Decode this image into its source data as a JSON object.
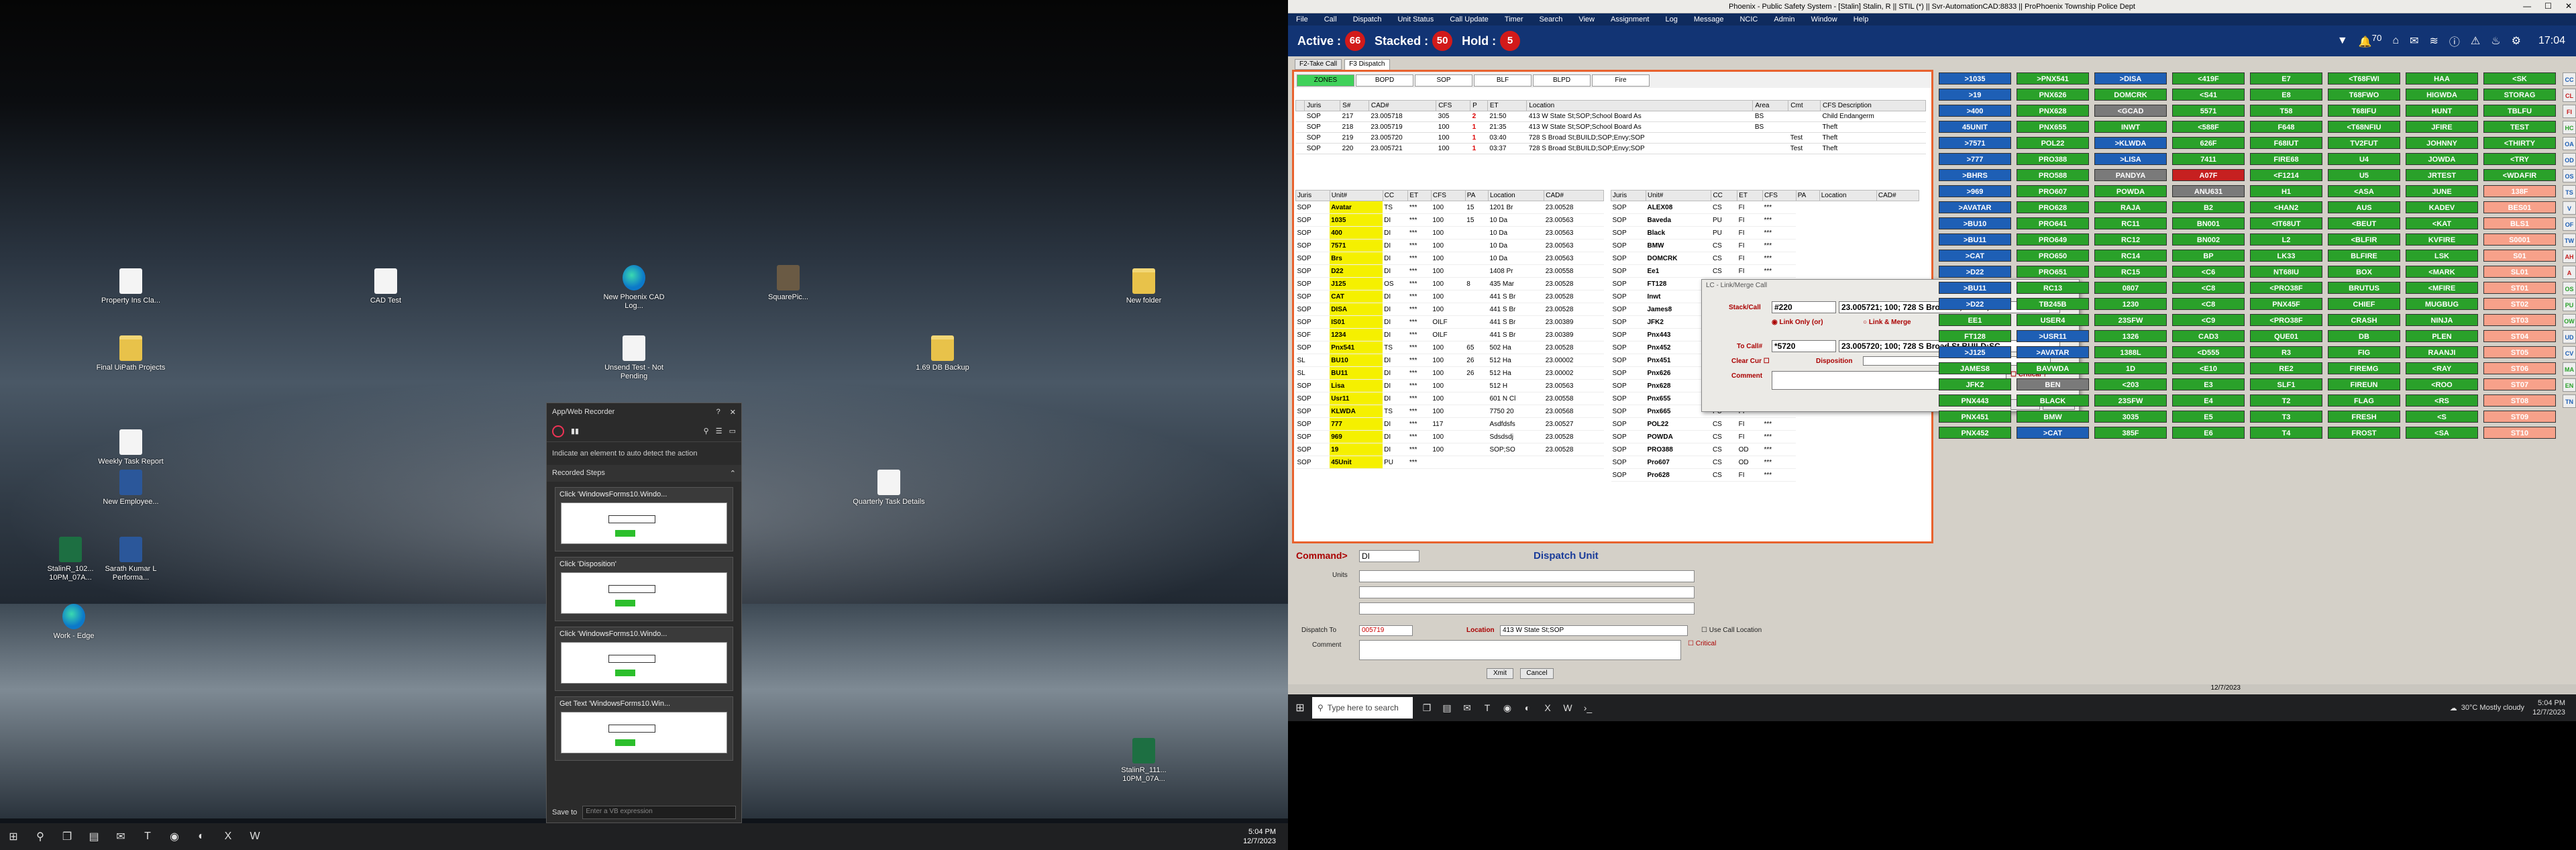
{
  "left_desktop": {
    "icons": [
      {
        "label": "Property Ins Cla...",
        "type": "doc"
      },
      {
        "label": "CAD Test",
        "type": "doc"
      },
      {
        "label": "New Phoenix CAD Log...",
        "type": "edge"
      },
      {
        "label": "SquarePic...",
        "type": "photo"
      },
      {
        "label": "New folder",
        "type": "folder"
      },
      {
        "label": "Final UiPath Projects",
        "type": "folder"
      },
      {
        "label": "Unsend Test - Not Pending",
        "type": "doc"
      },
      {
        "label": "1.69 DB Backup",
        "type": "folder"
      },
      {
        "label": "Weekly Task Report",
        "type": "doc"
      },
      {
        "label": "New Employee...",
        "type": "word"
      },
      {
        "label": "Quarterly Task Details",
        "type": "doc"
      },
      {
        "label": "StalinR_102... 10PM_07A...",
        "type": "excel"
      },
      {
        "label": "Sarath Kumar L Performa...",
        "type": "word"
      },
      {
        "label": "Work - Edge",
        "type": "edge"
      },
      {
        "label": "StalinR_111... 10PM_07A...",
        "type": "excel"
      }
    ],
    "recorder": {
      "title": "App/Web Recorder",
      "hint": "Indicate an element to auto detect the action",
      "recorded_steps": "Recorded Steps",
      "steps": [
        "Click 'WindowsForms10.Windo...",
        "Click 'Disposition'",
        "Click 'WindowsForms10.Windo...",
        "Get Text 'WindowsForms10.Win..."
      ],
      "save_to": "Save to",
      "save_placeholder": "Enter a VB expression"
    },
    "taskbar": {
      "time": "5:04 PM",
      "date": "12/7/2023"
    }
  },
  "app": {
    "title": "Phoenix - Public Safety System - [Stalin] Stalin, R || STIL (*) || Svr-AutomationCAD:8833 || ProPhoenix Township Police Dept",
    "menu": [
      "File",
      "Call",
      "Dispatch",
      "Unit Status",
      "Call Update",
      "Timer",
      "Search",
      "View",
      "Assignment",
      "Log",
      "Message",
      "NCIC",
      "Admin",
      "Window",
      "Help"
    ],
    "status": {
      "active_label": "Active :",
      "active": "66",
      "stacked_label": "Stacked :",
      "stacked": "50",
      "hold_label": "Hold :",
      "hold": "5",
      "notif": "70",
      "clock": "17:04"
    },
    "tabs": [
      "F2-Take Call",
      "F3 Dispatch"
    ],
    "zones": [
      "ZONES",
      "BOPD",
      "SOP",
      "BLF",
      "BLPD",
      "Fire"
    ],
    "calls_headers": [
      "",
      "Juris",
      "S#",
      "CAD#",
      "CFS",
      "P",
      "ET",
      "Location",
      "Area",
      "Cmt",
      "CFS Description"
    ],
    "calls": [
      [
        "SOP",
        "217",
        "23.005718",
        "305",
        "2",
        "21:50",
        "413 W State St;SOP;School Board As",
        "BS",
        "",
        "Child Endangerm"
      ],
      [
        "SOP",
        "218",
        "23.005719",
        "100",
        "1",
        "21:35",
        "413 W State St;SOP;School Board As",
        "BS",
        "",
        "Theft"
      ],
      [
        "SOP",
        "219",
        "23.005720",
        "100",
        "1",
        "03:40",
        "728 S Broad St;BUILD;SOP;Envy;SOP",
        "",
        "Test",
        "Theft"
      ],
      [
        "SOP",
        "220",
        "23.005721",
        "100",
        "1",
        "03:37",
        "728 S Broad St;BUILD;SOP;Envy;SOP",
        "",
        "Test",
        "Theft"
      ]
    ],
    "unit_headers": [
      "Juris",
      "Unit#",
      "CC",
      "ET",
      "CFS",
      "PA",
      "Location",
      "CAD#"
    ],
    "units_left": [
      [
        "SOP",
        "Avatar",
        "TS",
        "***",
        "100",
        "15",
        "1201 Br",
        "23.00528"
      ],
      [
        "SOP",
        "1035",
        "DI",
        "***",
        "100",
        "15",
        "10 Da",
        "23.00563"
      ],
      [
        "SOP",
        "400",
        "DI",
        "***",
        "100",
        "",
        "10 Da",
        "23.00563"
      ],
      [
        "SOP",
        "7571",
        "DI",
        "***",
        "100",
        "",
        "10 Da",
        "23.00563"
      ],
      [
        "SOP",
        "Brs",
        "DI",
        "***",
        "100",
        "",
        "10 Da",
        "23.00563"
      ],
      [
        "SOP",
        "D22",
        "DI",
        "***",
        "100",
        "",
        "1408 Pr",
        "23.00558"
      ],
      [
        "SOP",
        "J125",
        "OS",
        "***",
        "100",
        "8",
        "435 Mar",
        "23.00528"
      ],
      [
        "SOP",
        "CAT",
        "DI",
        "***",
        "100",
        "",
        "441 S Br",
        "23.00528"
      ],
      [
        "SOP",
        "DISA",
        "DI",
        "***",
        "100",
        "",
        "441 S Br",
        "23.00528"
      ],
      [
        "SOP",
        "IS01",
        "DI",
        "***",
        "OILF",
        "",
        "441 S Br",
        "23.00389"
      ],
      [
        "SOF",
        "1234",
        "DI",
        "***",
        "OILF",
        "",
        "441 S Br",
        "23.00389"
      ],
      [
        "SOP",
        "Pnx541",
        "TS",
        "***",
        "100",
        "65",
        "502 Ha",
        "23.00528"
      ],
      [
        "SL",
        "BU10",
        "DI",
        "***",
        "100",
        "26",
        "512 Ha",
        "23.00002"
      ],
      [
        "SL",
        "BU11",
        "DI",
        "***",
        "100",
        "26",
        "512 Ha",
        "23.00002"
      ],
      [
        "SOP",
        "Lisa",
        "DI",
        "***",
        "100",
        "",
        "512 H",
        "23.00563"
      ],
      [
        "SOP",
        "Usr11",
        "DI",
        "***",
        "100",
        "",
        "601 N Cl",
        "23.00558"
      ],
      [
        "SOP",
        "KLWDA",
        "TS",
        "***",
        "100",
        "",
        "7750 20",
        "23.00568"
      ],
      [
        "SOP",
        "777",
        "DI",
        "***",
        "117",
        "",
        "Asdfdsfs",
        "23.00527"
      ],
      [
        "SOP",
        "969",
        "DI",
        "***",
        "100",
        "",
        "Sdsdsdj",
        "23.00528"
      ],
      [
        "SOP",
        "19",
        "DI",
        "***",
        "100",
        "",
        "SOP;SO",
        "23.00528"
      ],
      [
        "SOP",
        "45Unit",
        "PU",
        "***",
        "",
        "",
        "",
        ""
      ]
    ],
    "units_right": [
      [
        "SOP",
        "ALEX08",
        "CS",
        "FI",
        "***"
      ],
      [
        "SOP",
        "Baveda",
        "PU",
        "FI",
        "***"
      ],
      [
        "SOP",
        "Black",
        "PU",
        "FI",
        "***"
      ],
      [
        "SOP",
        "BMW",
        "CS",
        "FI",
        "***"
      ],
      [
        "SOP",
        "DOMCRK",
        "CS",
        "FI",
        "***"
      ],
      [
        "SOP",
        "Ee1",
        "CS",
        "FI",
        "***"
      ],
      [
        "SOP",
        "FT128",
        "CS",
        "FI",
        "***"
      ],
      [
        "SOP",
        "Inwt",
        "CS",
        "FI",
        "***"
      ],
      [
        "SOP",
        "James8",
        "CS",
        "FI",
        "***"
      ],
      [
        "SOP",
        "JFK2",
        "CS",
        "FI",
        "***"
      ],
      [
        "SOP",
        "Pnx443",
        "CS",
        "FI",
        "***"
      ],
      [
        "SOP",
        "Pnx452",
        "CS",
        "FI",
        "***"
      ],
      [
        "SOP",
        "Pnx451",
        "CS",
        "FI",
        "***"
      ],
      [
        "SOP",
        "Pnx626",
        "CS",
        "FI",
        "***"
      ],
      [
        "SOP",
        "Pnx628",
        "CS",
        "FI",
        "***"
      ],
      [
        "SOP",
        "Pnx655",
        "PU",
        "FI",
        "***"
      ],
      [
        "SOP",
        "Pnx665",
        "PU",
        "FI",
        "***"
      ],
      [
        "SOP",
        "POL22",
        "CS",
        "FI",
        "***"
      ],
      [
        "SOP",
        "POWDA",
        "CS",
        "FI",
        "***"
      ],
      [
        "SOP",
        "PRO388",
        "CS",
        "OD",
        "***"
      ],
      [
        "SOP",
        "Pro607",
        "CS",
        "OD",
        "***"
      ],
      [
        "SOP",
        "Pro628",
        "CS",
        "FI",
        "***"
      ]
    ],
    "dispatch": {
      "command_label": "Command>",
      "command_value": "DI",
      "title": "Dispatch Unit",
      "units_label": "Units",
      "dispatch_to_label": "Dispatch To",
      "dispatch_to_value": "005719",
      "location_label": "Location",
      "location_value": "413 W State St;SOP",
      "use_call_location": "Use Call Location",
      "critical": "Critical",
      "comment_label": "Comment",
      "exit": "Xmit",
      "cancel": "Cancel"
    },
    "link_dialog": {
      "title": "LC - Link/Merge Call",
      "stack_label": "Stack/Call",
      "stack_num": "#220",
      "stack_value": "23.005721; 100; 728 S Broad St,BUILD;",
      "link_only": "Link Only",
      "or": "(or)",
      "link_merge": "Link & Merge",
      "to_call_label": "To Call#",
      "to_call_num": "*5720",
      "to_call_value": "23.005720; 100; 728 S Broad St,BUILD;SC",
      "clear_cur": "Clear Cur",
      "disposition": "Disposition",
      "critical": "Critical ?",
      "comment": "Comment",
      "xmit": "Xmit",
      "cancel": "Cancel"
    },
    "unit_buttons": [
      [
        "b",
        ">1035"
      ],
      [
        "g",
        ">PNX541"
      ],
      [
        "b",
        ">DISA"
      ],
      [
        "g",
        "<419F"
      ],
      [
        "g",
        "E7"
      ],
      [
        "g",
        "<T68FWI"
      ],
      [
        "g",
        "HAA"
      ],
      [
        "g",
        "<SK"
      ],
      [
        "b",
        ">19"
      ],
      [
        "g",
        "PNX626"
      ],
      [
        "g",
        "DOMCRK"
      ],
      [
        "g",
        "<S41"
      ],
      [
        "g",
        "E8"
      ],
      [
        "g",
        "T68FWO"
      ],
      [
        "g",
        "HIGWDA"
      ],
      [
        "g",
        "STORAG"
      ],
      [
        "b",
        ">400"
      ],
      [
        "g",
        "PNX628"
      ],
      [
        "gr",
        "<GCAD"
      ],
      [
        "g",
        "5571"
      ],
      [
        "g",
        "T58"
      ],
      [
        "g",
        "T68IFU"
      ],
      [
        "g",
        "HUNT"
      ],
      [
        "g",
        "TBLFU"
      ],
      [
        "b",
        "45UNIT"
      ],
      [
        "g",
        "PNX655"
      ],
      [
        "g",
        "INWT"
      ],
      [
        "g",
        "<588F"
      ],
      [
        "g",
        "F648"
      ],
      [
        "g",
        "<T68NFIU"
      ],
      [
        "g",
        "JFIRE"
      ],
      [
        "g",
        "TEST"
      ],
      [
        "b",
        ">7571"
      ],
      [
        "g",
        "POL22"
      ],
      [
        "b",
        ">KLWDA"
      ],
      [
        "g",
        "626F"
      ],
      [
        "g",
        "F68IUT"
      ],
      [
        "g",
        "TV2FUT"
      ],
      [
        "g",
        "JOHNNY"
      ],
      [
        "g",
        "<THIRTY"
      ],
      [
        "b",
        ">777"
      ],
      [
        "g",
        "PRO388"
      ],
      [
        "b",
        ">LISA"
      ],
      [
        "g",
        "7411"
      ],
      [
        "g",
        "FIRE68"
      ],
      [
        "g",
        "U4"
      ],
      [
        "g",
        "JOWDA"
      ],
      [
        "g",
        "<TRY"
      ],
      [
        "b",
        ">BHRS"
      ],
      [
        "g",
        "PRO588"
      ],
      [
        "gr",
        "PANDYA"
      ],
      [
        "r",
        "A07F"
      ],
      [
        "g",
        "<F1214"
      ],
      [
        "g",
        "U5"
      ],
      [
        "g",
        "JRTEST"
      ],
      [
        "g",
        "<WDAFIR"
      ],
      [
        "b",
        ">969"
      ],
      [
        "g",
        "PRO607"
      ],
      [
        "g",
        "POWDA"
      ],
      [
        "gr",
        "ANU631"
      ],
      [
        "g",
        "H1"
      ],
      [
        "g",
        "<ASA"
      ],
      [
        "g",
        "JUNE"
      ],
      [
        "s",
        "138F"
      ],
      [
        "b",
        ">AVATAR"
      ],
      [
        "g",
        "PRO628"
      ],
      [
        "g",
        "RAJA"
      ],
      [
        "g",
        "B2"
      ],
      [
        "g",
        "<HAN2"
      ],
      [
        "g",
        "AUS"
      ],
      [
        "g",
        "KADEV"
      ],
      [
        "s",
        "BES01"
      ],
      [
        "b",
        ">BU10"
      ],
      [
        "g",
        "PRO641"
      ],
      [
        "g",
        "RC11"
      ],
      [
        "g",
        "BN001"
      ],
      [
        "g",
        "<IT68UT"
      ],
      [
        "g",
        "<BEUT"
      ],
      [
        "g",
        "<KAT"
      ],
      [
        "s",
        "BLS1"
      ],
      [
        "b",
        ">BU11"
      ],
      [
        "g",
        "PRO649"
      ],
      [
        "g",
        "RC12"
      ],
      [
        "g",
        "BN002"
      ],
      [
        "g",
        "L2"
      ],
      [
        "g",
        "<BLFIR"
      ],
      [
        "g",
        "KVFIRE"
      ],
      [
        "s",
        "S0001"
      ],
      [
        "b",
        ">CAT"
      ],
      [
        "g",
        "PRO650"
      ],
      [
        "g",
        "RC14"
      ],
      [
        "g",
        "BP"
      ],
      [
        "g",
        "LK33"
      ],
      [
        "g",
        "BLFIRE"
      ],
      [
        "g",
        "LSK"
      ],
      [
        "s",
        "S01"
      ],
      [
        "b",
        ">D22"
      ],
      [
        "g",
        "PRO651"
      ],
      [
        "g",
        "RC15"
      ],
      [
        "g",
        "<C6"
      ],
      [
        "g",
        "NT68IU"
      ],
      [
        "g",
        "BOX"
      ],
      [
        "g",
        "<MARK"
      ],
      [
        "s",
        "SL01"
      ],
      [
        "b",
        ">BU11"
      ],
      [
        "g",
        "RC13"
      ],
      [
        "g",
        "0807"
      ],
      [
        "g",
        "<C8"
      ],
      [
        "g",
        "<PRO38F"
      ],
      [
        "g",
        "BRUTUS"
      ],
      [
        "g",
        "<MFIRE"
      ],
      [
        "s",
        "ST01"
      ],
      [
        "b",
        ">D22"
      ],
      [
        "g",
        "TB245B"
      ],
      [
        "g",
        "1230"
      ],
      [
        "g",
        "<C8"
      ],
      [
        "g",
        "PNX45F"
      ],
      [
        "g",
        "CHIEF"
      ],
      [
        "g",
        "MUGBUG"
      ],
      [
        "s",
        "ST02"
      ],
      [
        "g",
        "EE1"
      ],
      [
        "g",
        "USER4"
      ],
      [
        "g",
        "23SFW"
      ],
      [
        "g",
        "<C9"
      ],
      [
        "g",
        "<PRO38F"
      ],
      [
        "g",
        "CRASH"
      ],
      [
        "g",
        "NINJA"
      ],
      [
        "s",
        "ST03"
      ],
      [
        "g",
        "FT128"
      ],
      [
        "b",
        ">USR11"
      ],
      [
        "g",
        "1326"
      ],
      [
        "g",
        "CAD3"
      ],
      [
        "g",
        "QUE01"
      ],
      [
        "g",
        "DB"
      ],
      [
        "g",
        "PLEN"
      ],
      [
        "s",
        "ST04"
      ],
      [
        "b",
        ">J125"
      ],
      [
        "b",
        ">AVATAR"
      ],
      [
        "g",
        "1388L"
      ],
      [
        "g",
        "<D555"
      ],
      [
        "g",
        "R3"
      ],
      [
        "g",
        "FIG"
      ],
      [
        "g",
        "RAANJI"
      ],
      [
        "s",
        "ST05"
      ],
      [
        "g",
        "JAMES8"
      ],
      [
        "g",
        "BAVWDA"
      ],
      [
        "g",
        "1D"
      ],
      [
        "g",
        "<E10"
      ],
      [
        "g",
        "RE2"
      ],
      [
        "g",
        "FIREMG"
      ],
      [
        "g",
        "<RAY"
      ],
      [
        "s",
        "ST06"
      ],
      [
        "g",
        "JFK2"
      ],
      [
        "gr",
        "BEN"
      ],
      [
        "g",
        "<203"
      ],
      [
        "g",
        "E3"
      ],
      [
        "g",
        "SLF1"
      ],
      [
        "g",
        "FIREUN"
      ],
      [
        "g",
        "<ROO"
      ],
      [
        "s",
        "ST07"
      ],
      [
        "g",
        "PNX443"
      ],
      [
        "g",
        "BLACK"
      ],
      [
        "g",
        "23SFW"
      ],
      [
        "g",
        "E4"
      ],
      [
        "g",
        "T2"
      ],
      [
        "g",
        "FLAG"
      ],
      [
        "g",
        "<RS"
      ],
      [
        "s",
        "ST08"
      ],
      [
        "g",
        "PNX451"
      ],
      [
        "g",
        "BMW"
      ],
      [
        "g",
        "3035"
      ],
      [
        "g",
        "E5"
      ],
      [
        "g",
        "T3"
      ],
      [
        "g",
        "FRESH"
      ],
      [
        "g",
        "<S"
      ],
      [
        "s",
        "ST09"
      ],
      [
        "g",
        "PNX452"
      ],
      [
        "b",
        ">CAT"
      ],
      [
        "g",
        "385F"
      ],
      [
        "g",
        "E6"
      ],
      [
        "g",
        "T4"
      ],
      [
        "g",
        "FROST"
      ],
      [
        "g",
        "<SA"
      ],
      [
        "s",
        "ST10"
      ]
    ],
    "side_tabs": [
      "CC",
      "CL",
      "FI",
      "HC",
      "OA",
      "OD",
      "OS",
      "TS",
      "V",
      "OF",
      "TW",
      "AH",
      "A",
      "OS",
      "PU",
      "OW",
      "UD",
      "CV",
      "MA",
      "EN",
      "TN"
    ],
    "date_bar": "12/7/2023",
    "taskbar": {
      "search": "Type here to search",
      "weather": "30°C  Mostly cloudy",
      "time": "5:04 PM",
      "date": "12/7/2023"
    }
  }
}
